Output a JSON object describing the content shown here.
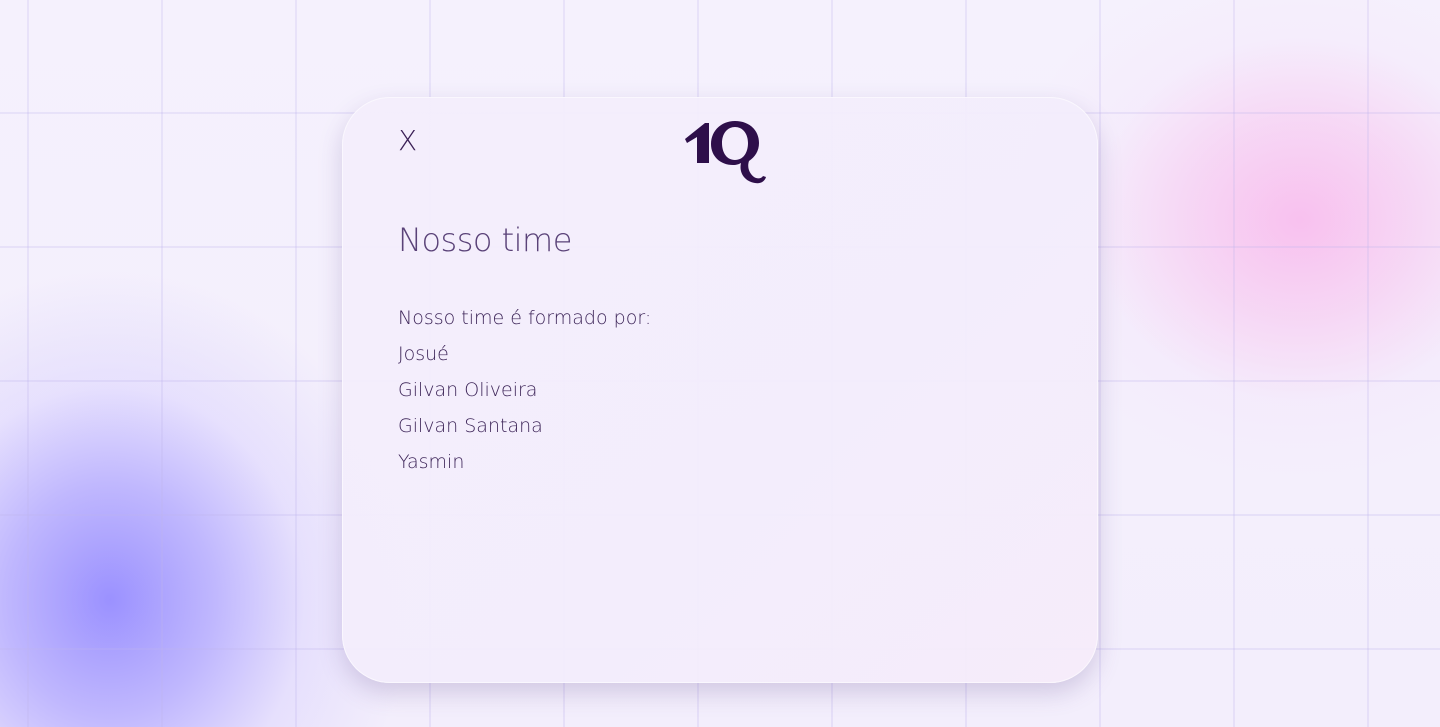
{
  "modal": {
    "close_label": "X",
    "logo_text": "1Q",
    "title": "Nosso time",
    "intro": "Nosso time é formado por:",
    "members": [
      "Josué",
      "Gilvan Oliveira",
      "Gilvan Santana",
      "Yasmin"
    ]
  },
  "colors": {
    "text_primary": "#3e2659",
    "logo": "#2e0f4a",
    "accent_purple": "#968cff",
    "accent_pink": "#f8bee e"
  }
}
